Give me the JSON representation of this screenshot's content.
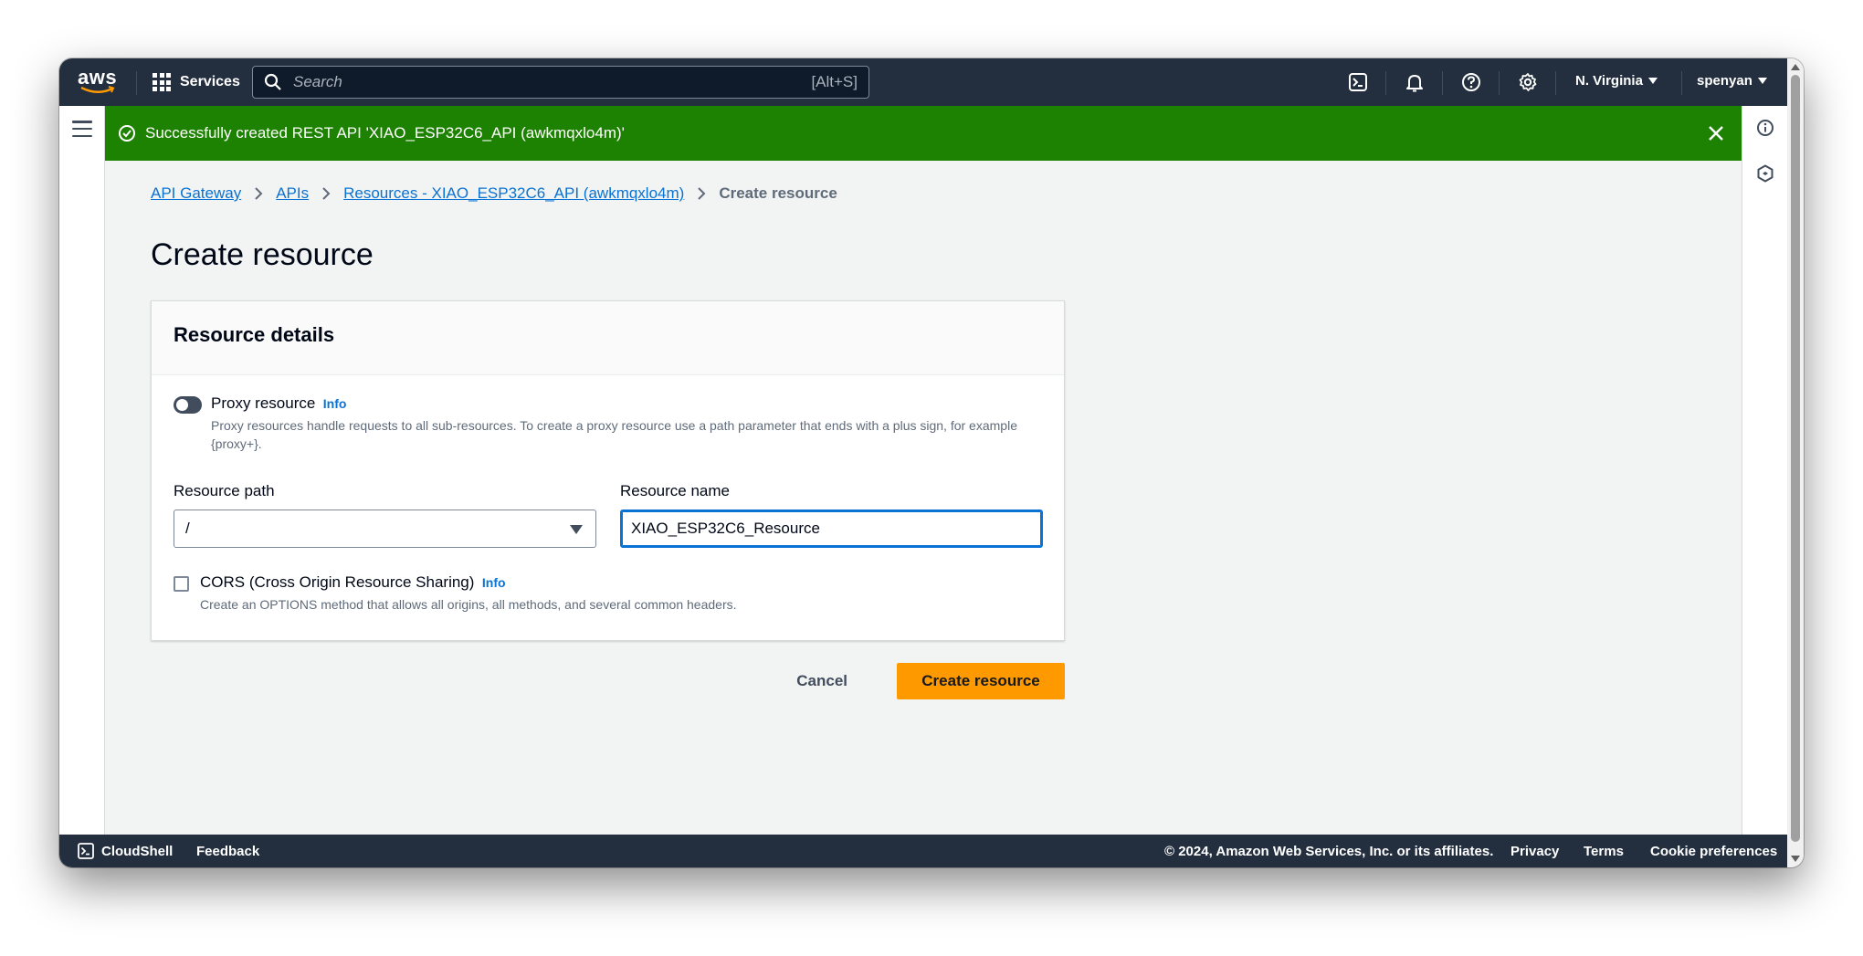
{
  "topnav": {
    "logo_text": "aws",
    "services_label": "Services",
    "search_placeholder": "Search",
    "search_shortcut": "[Alt+S]",
    "region": "N. Virginia",
    "user": "spenyan"
  },
  "flash": {
    "message": "Successfully created REST API 'XIAO_ESP32C6_API (awkmqxlo4m)'",
    "color": "#1d8102"
  },
  "breadcrumb": {
    "items": [
      "API Gateway",
      "APIs",
      "Resources - XIAO_ESP32C6_API (awkmqxlo4m)"
    ],
    "current": "Create resource"
  },
  "page": {
    "title": "Create resource"
  },
  "resource_details": {
    "header": "Resource details",
    "proxy_label": "Proxy resource",
    "proxy_info": "Info",
    "proxy_description": "Proxy resources handle requests to all sub-resources. To create a proxy resource use a path parameter that ends with a plus sign, for example {proxy+}.",
    "path_label": "Resource path",
    "path_value": "/",
    "name_label": "Resource name",
    "name_value": "XIAO_ESP32C6_Resource",
    "cors_label": "CORS (Cross Origin Resource Sharing)",
    "cors_info": "Info",
    "cors_description": "Create an OPTIONS method that allows all origins, all methods, and several common headers."
  },
  "actions": {
    "cancel": "Cancel",
    "submit": "Create resource",
    "primary_color": "#ff9900"
  },
  "footer": {
    "cloudshell": "CloudShell",
    "feedback": "Feedback",
    "copyright": "© 2024, Amazon Web Services, Inc. or its affiliates.",
    "privacy": "Privacy",
    "terms": "Terms",
    "cookies": "Cookie preferences"
  },
  "colors": {
    "nav_bg": "#232f3e",
    "link": "#0972d3"
  }
}
